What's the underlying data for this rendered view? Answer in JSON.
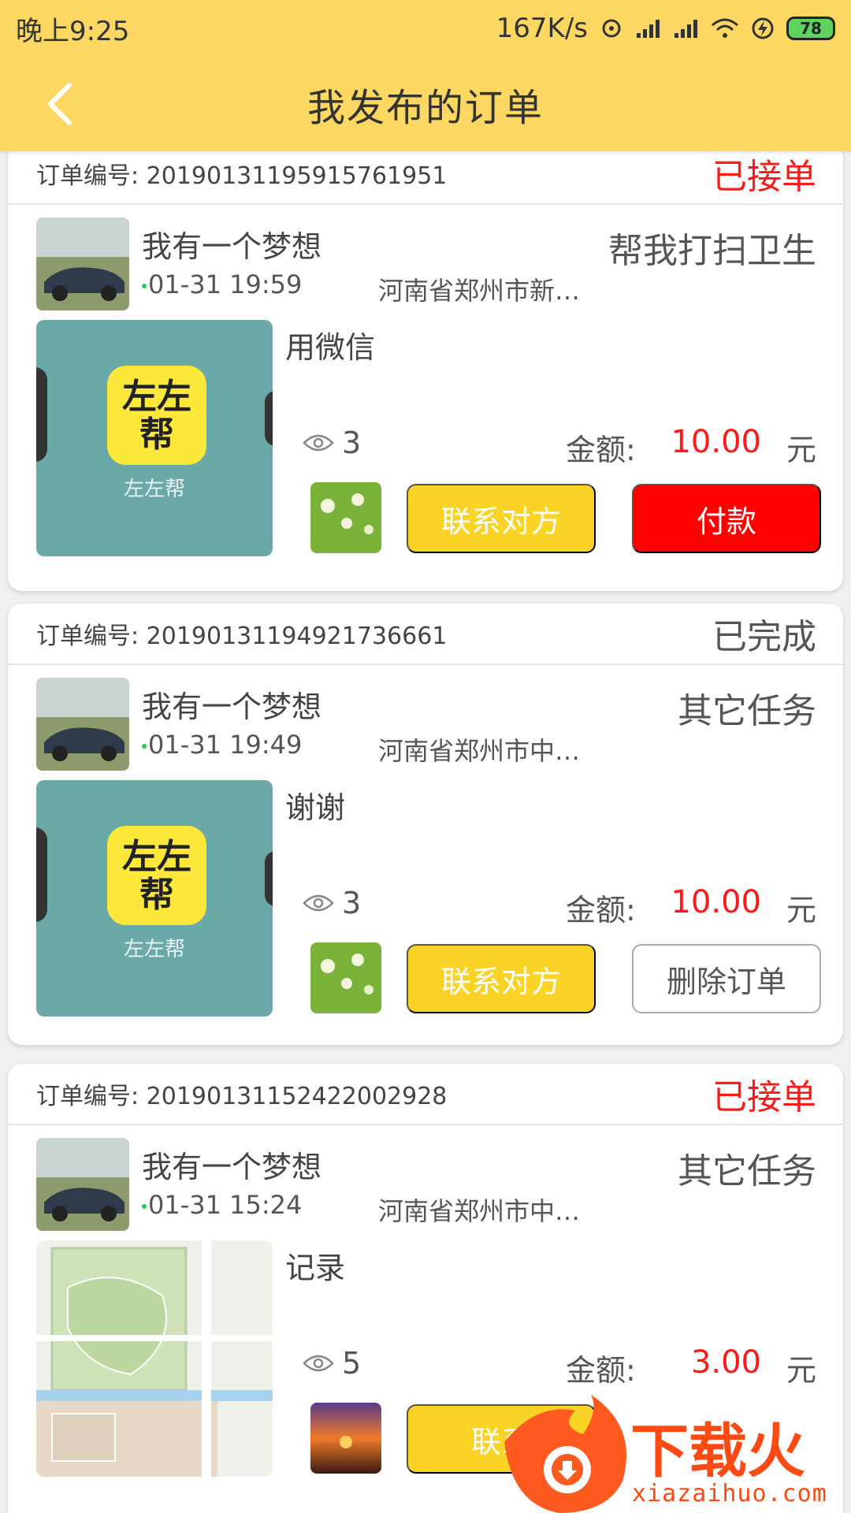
{
  "statusbar": {
    "time": "晚上9:25",
    "speed": "167K/s",
    "battery": "78"
  },
  "appbar": {
    "title": "我发布的订单"
  },
  "orders": [
    {
      "order_no": "订单编号: 20190131195915761951",
      "status": "已接单",
      "nickname": "我有一个梦想",
      "date": "01-31 19:59",
      "address": "河南省郑州市新…",
      "task": "帮我打扫卫生",
      "desc": "用微信",
      "views": "3",
      "amount_label": "金额:",
      "amount": "10.00",
      "unit": "元",
      "contact_label": "联系对方",
      "action_label": "付款",
      "thumb_logo_text": "左左帮",
      "thumb_caption": "左左帮"
    },
    {
      "order_no": "订单编号: 20190131194921736661",
      "status": "已完成",
      "nickname": "我有一个梦想",
      "date": "01-31 19:49",
      "address": "河南省郑州市中…",
      "task": "其它任务",
      "desc": "谢谢",
      "views": "3",
      "amount_label": "金额:",
      "amount": "10.00",
      "unit": "元",
      "contact_label": "联系对方",
      "action_label": "删除订单",
      "thumb_logo_text": "左左帮",
      "thumb_caption": "左左帮"
    },
    {
      "order_no": "订单编号: 20190131152422002928",
      "status": "已接单",
      "nickname": "我有一个梦想",
      "date": "01-31 15:24",
      "address": "河南省郑州市中…",
      "task": "其它任务",
      "desc": "记录",
      "views": "5",
      "amount_label": "金额:",
      "amount": "3.00",
      "unit": "元",
      "contact_label": "联系"
    }
  ],
  "watermark": {
    "brand": "下载火",
    "domain": "xiazaihuo.com"
  },
  "colors": {
    "appbar": "#fcd862",
    "accent_yellow": "#f9d325",
    "status_red": "#ff1a1a",
    "pay_red": "#ff0000"
  },
  "icons": [
    "back-arrow-icon",
    "eye-icon",
    "signal-icon",
    "wifi-icon",
    "battery-icon"
  ]
}
